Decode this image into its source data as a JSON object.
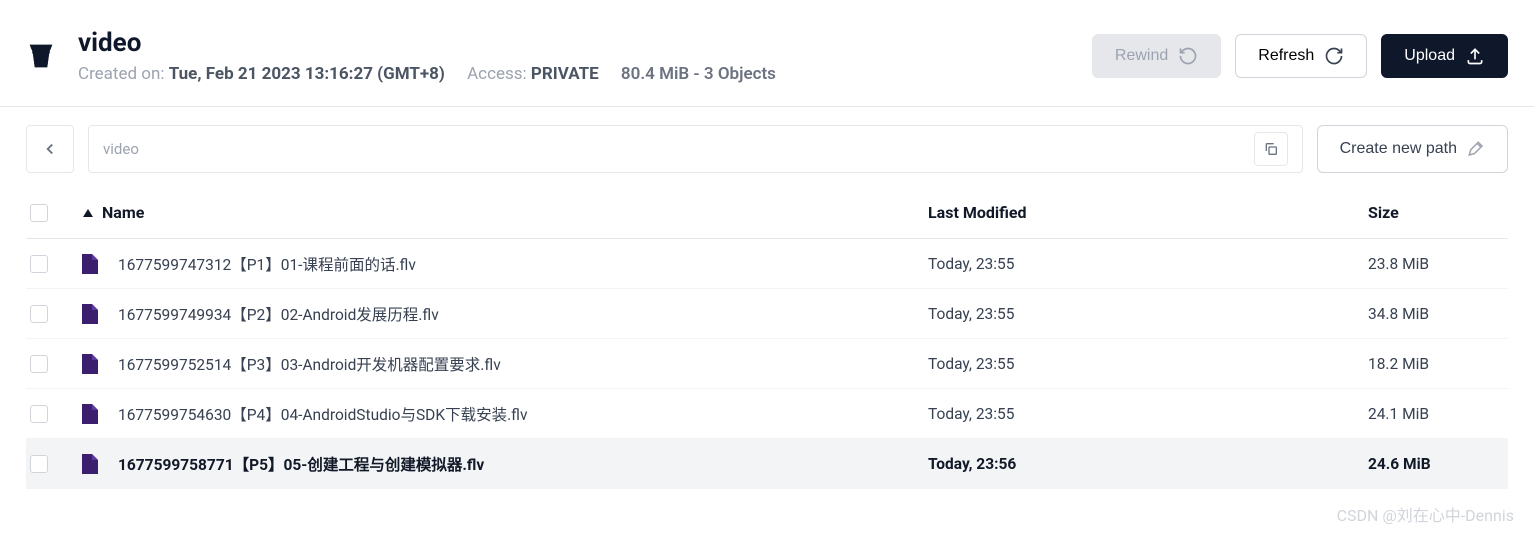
{
  "header": {
    "title": "video",
    "created_label": "Created on:",
    "created_value": "Tue, Feb 21 2023 13:16:27 (GMT+8)",
    "access_label": "Access:",
    "access_value": "PRIVATE",
    "stats": "80.4 MiB - 3 Objects",
    "rewind_label": "Rewind",
    "refresh_label": "Refresh",
    "upload_label": "Upload"
  },
  "toolbar": {
    "breadcrumb": "video",
    "create_path_label": "Create new path"
  },
  "columns": {
    "name": "Name",
    "modified": "Last Modified",
    "size": "Size"
  },
  "files": [
    {
      "name": "1677599747312【P1】01-课程前面的话.flv",
      "modified": "Today, 23:55",
      "size": "23.8 MiB",
      "active": false
    },
    {
      "name": "1677599749934【P2】02-Android发展历程.flv",
      "modified": "Today, 23:55",
      "size": "34.8 MiB",
      "active": false
    },
    {
      "name": "1677599752514【P3】03-Android开发机器配置要求.flv",
      "modified": "Today, 23:55",
      "size": "18.2 MiB",
      "active": false
    },
    {
      "name": "1677599754630【P4】04-AndroidStudio与SDK下载安装.flv",
      "modified": "Today, 23:55",
      "size": "24.1 MiB",
      "active": false
    },
    {
      "name": "1677599758771【P5】05-创建工程与创建模拟器.flv",
      "modified": "Today, 23:56",
      "size": "24.6 MiB",
      "active": true
    }
  ],
  "watermark": "CSDN @刘在心中-Dennis"
}
